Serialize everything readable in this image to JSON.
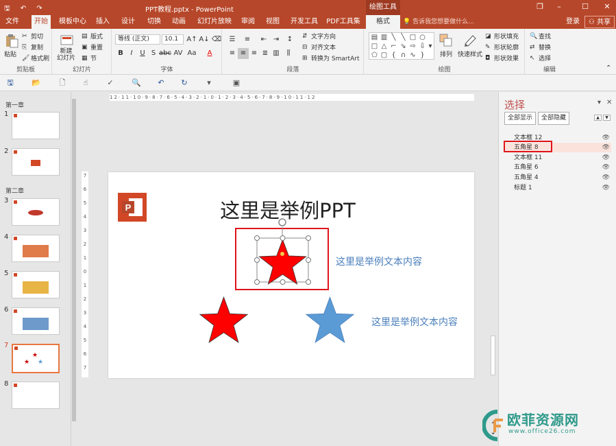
{
  "titlebar": {
    "title": "PPT教程.pptx - PowerPoint",
    "context_group": "绘图工具",
    "controls": [
      "restore-icon",
      "minimize-icon",
      "maximize-icon",
      "close-icon"
    ]
  },
  "tabs": {
    "items": [
      "文件",
      "开始",
      "模板中心",
      "插入",
      "设计",
      "切换",
      "动画",
      "幻灯片放映",
      "审阅",
      "视图",
      "开发工具",
      "PDF工具集",
      "格式"
    ],
    "active": "开始",
    "tell_me": "告诉我您想要做什么...",
    "login": "登录",
    "share": "共享"
  },
  "ribbon": {
    "clipboard": {
      "paste": "粘贴",
      "cut": "剪切",
      "copy": "复制",
      "format_painter": "格式刷",
      "label": "剪贴板"
    },
    "slides": {
      "new_slide": "新建\n幻灯片",
      "layout": "版式",
      "reset": "重置",
      "section": "节",
      "label": "幻灯片"
    },
    "font": {
      "name": "等线 (正文)",
      "size": "10.1",
      "label": "字体"
    },
    "paragraph": {
      "text_direction": "文字方向",
      "align_text": "对齐文本",
      "smartart": "转换为 SmartArt",
      "label": "段落"
    },
    "drawing": {
      "arrange": "排列",
      "quick_styles": "快速样式",
      "shape_fill": "形状填充",
      "shape_outline": "形状轮廓",
      "shape_effects": "形状效果",
      "label": "绘图"
    },
    "editing": {
      "find": "查找",
      "replace": "替换",
      "select": "选择",
      "label": "编辑"
    }
  },
  "thumbnails": {
    "sections": [
      "第一章",
      "第二章"
    ],
    "numbers": [
      "1",
      "2",
      "3",
      "4",
      "5",
      "6",
      "7",
      "8"
    ],
    "selected": "7"
  },
  "ruler": {
    "horizontal": "12·11·10·9·8·7·6·5·4·3·2·1·0·1·2·3·4·5·6·7·8·9·10·11·12",
    "vertical": [
      "7",
      "6",
      "5",
      "4",
      "3",
      "2",
      "1",
      "0",
      "1",
      "2",
      "3",
      "4",
      "5",
      "6",
      "7"
    ]
  },
  "slide": {
    "title": "这里是举例PPT",
    "text1": "这里是举例文本内容",
    "text2": "这里是举例文本内容",
    "star_colors": {
      "red": "#ff0000",
      "blue": "#5b9bd5"
    }
  },
  "selection_pane": {
    "title": "选择",
    "show_all": "全部显示",
    "hide_all": "全部隐藏",
    "items": [
      "文本框 12",
      "五角星 8",
      "文本框 11",
      "五角星 6",
      "五角星 4",
      "标题 1"
    ],
    "selected": "五角星 8"
  },
  "watermark": {
    "text": "欧菲资源网",
    "url": "www.office26.com"
  },
  "colors": {
    "accent": "#b7472a",
    "highlight": "#e0131a"
  }
}
